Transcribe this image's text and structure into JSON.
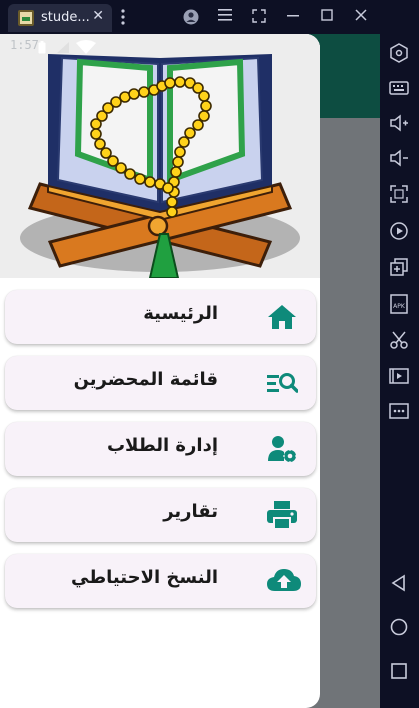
{
  "window": {
    "tab_title": "stude...",
    "tab_close": "✕"
  },
  "statusbar": {
    "time": "1:57"
  },
  "menu": {
    "items": [
      {
        "label": "الرئيسية",
        "icon": "home-icon"
      },
      {
        "label": "قائمة المحضرين",
        "icon": "list-search-icon"
      },
      {
        "label": "إدارة الطلاب",
        "icon": "user-settings-icon"
      },
      {
        "label": "تقارير",
        "icon": "printer-icon"
      },
      {
        "label": "النسخ الاحتياطي",
        "icon": "cloud-upload-icon"
      }
    ]
  },
  "colors": {
    "accent": "#0e8a7a",
    "appbar": "#0d4d41",
    "menu_bg": "#f8f2f9"
  },
  "sidebar_icons": [
    "settings-hex-icon",
    "keyboard-icon",
    "volume-up-icon",
    "volume-down-icon",
    "fullscreen-icon",
    "record-icon",
    "multi-instance-icon",
    "apk-icon",
    "scissors-icon",
    "media-icon",
    "more-icon",
    "back-icon",
    "home-circle-icon",
    "recents-icon"
  ]
}
